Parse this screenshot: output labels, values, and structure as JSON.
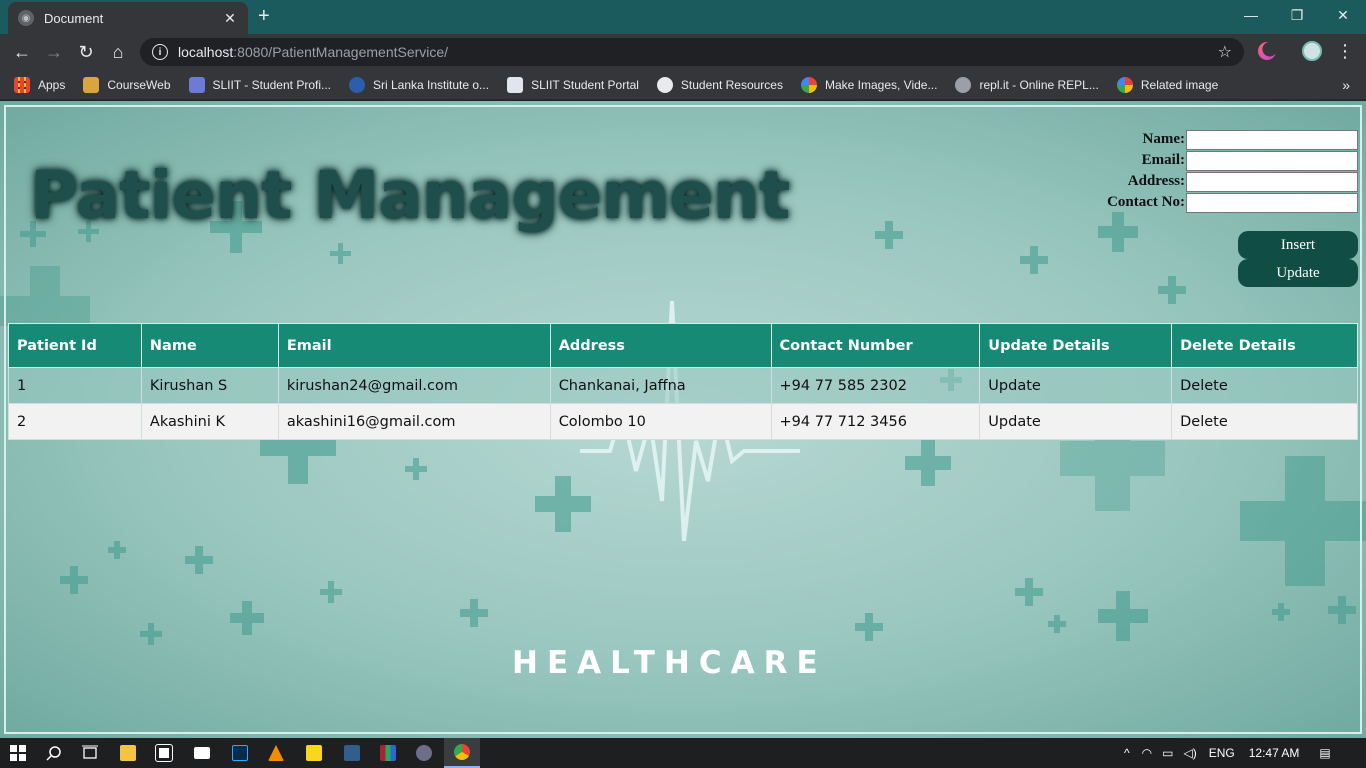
{
  "browser": {
    "tab_title": "Document",
    "url_host": "localhost",
    "url_path": ":8080/PatientManagementService/",
    "bookmarks": [
      {
        "label": "Apps",
        "icon": "apps-grid-icon",
        "color": "#e74c3c"
      },
      {
        "label": "CourseWeb",
        "icon": "courseweb-icon",
        "color": "#d9a441"
      },
      {
        "label": "SLIIT - Student Profi...",
        "icon": "sliit-icon",
        "color": "#6b7bd6"
      },
      {
        "label": "Sri Lanka Institute o...",
        "icon": "sliit-globe-icon",
        "color": "#2b5fab"
      },
      {
        "label": "SLIIT Student Portal",
        "icon": "document-icon",
        "color": "#dfe6ee"
      },
      {
        "label": "Student Resources",
        "icon": "globe-icon",
        "color": "#e8eaed"
      },
      {
        "label": "Make Images, Vide...",
        "icon": "google-icon",
        "color": "#4285f4"
      },
      {
        "label": "repl.it - Online REPL...",
        "icon": "replit-icon",
        "color": "#9aa0a6"
      },
      {
        "label": "Related image",
        "icon": "google-icon",
        "color": "#4285f4"
      }
    ]
  },
  "page": {
    "title": "Patient Management",
    "form": {
      "name_label": "Name:",
      "email_label": "Email:",
      "address_label": "Address:",
      "contact_label": "Contact No:",
      "name_value": "",
      "email_value": "",
      "address_value": "",
      "contact_value": ""
    },
    "insert_label": "Insert",
    "update_label": "Update",
    "table": {
      "headers": [
        "Patient Id",
        "Name",
        "Email",
        "Address",
        "Contact Number",
        "Update Details",
        "Delete Details"
      ],
      "rows": [
        {
          "id": "1",
          "name": "Kirushan S",
          "email": "kirushan24@gmail.com",
          "address": "Chankanai, Jaffna",
          "contact": "+94 77 585 2302",
          "update": "Update",
          "delete": "Delete"
        },
        {
          "id": "2",
          "name": "Akashini K",
          "email": "akashini16@gmail.com",
          "address": "Colombo 10",
          "contact": "+94 77 712 3456",
          "update": "Update",
          "delete": "Delete"
        }
      ]
    },
    "footer_text": "HEALTHCARE",
    "colors": {
      "header": "#168a74",
      "button": "#0f4d45",
      "background": "#98c6be"
    }
  },
  "taskbar": {
    "language": "ENG",
    "time": "12:47 AM"
  }
}
